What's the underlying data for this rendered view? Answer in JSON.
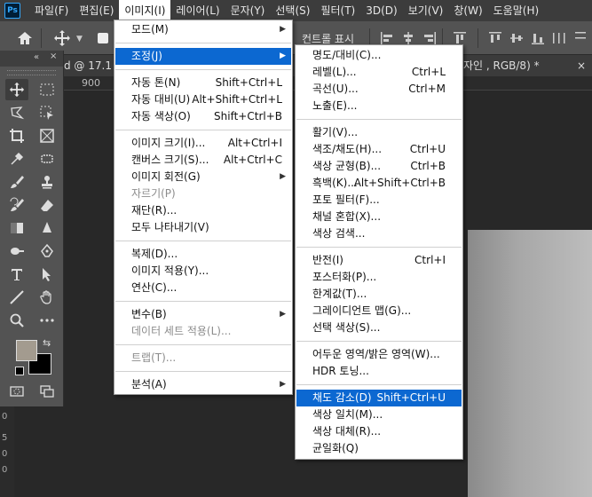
{
  "app": {
    "logo": "Ps"
  },
  "menubar": [
    {
      "label": "파일(F)",
      "active": false
    },
    {
      "label": "편집(E)",
      "active": false
    },
    {
      "label": "이미지(I)",
      "active": true
    },
    {
      "label": "레이어(L)",
      "active": false
    },
    {
      "label": "문자(Y)",
      "active": false
    },
    {
      "label": "선택(S)",
      "active": false
    },
    {
      "label": "필터(T)",
      "active": false
    },
    {
      "label": "3D(D)",
      "active": false
    },
    {
      "label": "보기(V)",
      "active": false
    },
    {
      "label": "창(W)",
      "active": false
    },
    {
      "label": "도움말(H)",
      "active": false
    }
  ],
  "options": {
    "show_transform_label": "컨트롤 표시"
  },
  "tabs": {
    "doc_tab_left": "d @ 17.1",
    "doc_tab_right": "자인 , RGB/8) *",
    "close": "×"
  },
  "ruler": {
    "h_label": "900",
    "v_labels": [
      "0",
      "5",
      "0",
      "0"
    ]
  },
  "colors": {
    "foreground": "#a39b8f",
    "background": "#000000",
    "highlight": "#0c68d1"
  },
  "image_menu": {
    "items": [
      {
        "label": "모드(M)",
        "submenu": true
      },
      {
        "sep": true
      },
      {
        "label": "조정(J)",
        "submenu": true,
        "highlighted": true
      },
      {
        "sep": true
      },
      {
        "label": "자동 톤(N)",
        "shortcut": "Shift+Ctrl+L"
      },
      {
        "label": "자동 대비(U)",
        "shortcut": "Alt+Shift+Ctrl+L"
      },
      {
        "label": "자동 색상(O)",
        "shortcut": "Shift+Ctrl+B"
      },
      {
        "sep": true
      },
      {
        "label": "이미지 크기(I)...",
        "shortcut": "Alt+Ctrl+I"
      },
      {
        "label": "캔버스 크기(S)...",
        "shortcut": "Alt+Ctrl+C"
      },
      {
        "label": "이미지 회전(G)",
        "submenu": true
      },
      {
        "label": "자르기(P)",
        "disabled": true
      },
      {
        "label": "재단(R)..."
      },
      {
        "label": "모두 나타내기(V)"
      },
      {
        "sep": true
      },
      {
        "label": "복제(D)..."
      },
      {
        "label": "이미지 적용(Y)..."
      },
      {
        "label": "연산(C)..."
      },
      {
        "sep": true
      },
      {
        "label": "변수(B)",
        "submenu": true
      },
      {
        "label": "데이터 세트 적용(L)...",
        "disabled": true
      },
      {
        "sep": true
      },
      {
        "label": "트랩(T)...",
        "disabled": true
      },
      {
        "sep": true
      },
      {
        "label": "분석(A)",
        "submenu": true
      }
    ]
  },
  "adjust_menu": {
    "items": [
      {
        "label": "명도/대비(C)..."
      },
      {
        "label": "레벨(L)...",
        "shortcut": "Ctrl+L"
      },
      {
        "label": "곡선(U)...",
        "shortcut": "Ctrl+M"
      },
      {
        "label": "노출(E)..."
      },
      {
        "sep": true
      },
      {
        "label": "활기(V)..."
      },
      {
        "label": "색조/채도(H)...",
        "shortcut": "Ctrl+U"
      },
      {
        "label": "색상 균형(B)...",
        "shortcut": "Ctrl+B"
      },
      {
        "label": "흑백(K)...",
        "shortcut": "Alt+Shift+Ctrl+B"
      },
      {
        "label": "포토 필터(F)..."
      },
      {
        "label": "채널 혼합(X)..."
      },
      {
        "label": "색상 검색..."
      },
      {
        "sep": true
      },
      {
        "label": "반전(I)",
        "shortcut": "Ctrl+I"
      },
      {
        "label": "포스터화(P)..."
      },
      {
        "label": "한계값(T)..."
      },
      {
        "label": "그레이디언트 맵(G)..."
      },
      {
        "label": "선택 색상(S)..."
      },
      {
        "sep": true
      },
      {
        "label": "어두운 영역/밝은 영역(W)..."
      },
      {
        "label": "HDR 토닝..."
      },
      {
        "sep": true
      },
      {
        "label": "채도 감소(D)",
        "shortcut": "Shift+Ctrl+U",
        "highlighted": true
      },
      {
        "label": "색상 일치(M)..."
      },
      {
        "label": "색상 대체(R)..."
      },
      {
        "label": "균일화(Q)"
      }
    ]
  }
}
